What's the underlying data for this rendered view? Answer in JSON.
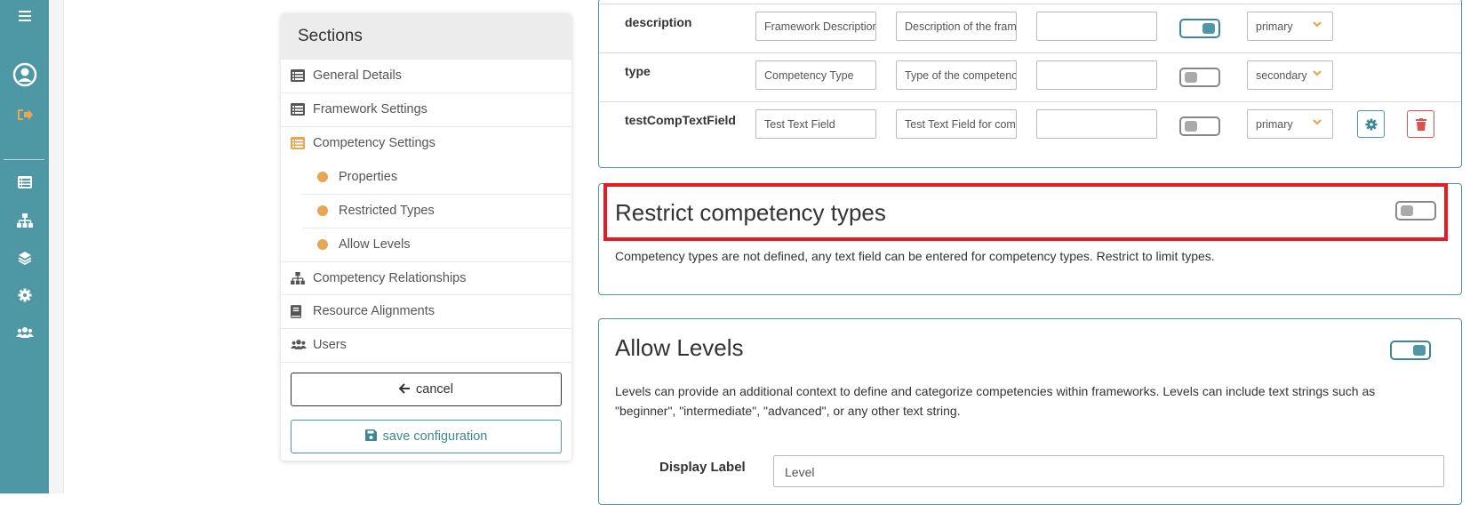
{
  "sidebar_icons": [
    "menu-icon",
    "user-circle-icon",
    "sign-out-icon",
    "list-icon",
    "sitemap-icon",
    "layers-icon",
    "gear-icon",
    "users-icon"
  ],
  "sections": {
    "title": "Sections",
    "items": [
      {
        "label": "General Details",
        "icon": "list-icon"
      },
      {
        "label": "Framework Settings",
        "icon": "list-icon"
      },
      {
        "label": "Competency Settings",
        "icon": "list-icon",
        "active": true
      },
      {
        "label": "Competency Relationships",
        "icon": "sitemap-icon"
      },
      {
        "label": "Resource Alignments",
        "icon": "book-icon"
      },
      {
        "label": "Users",
        "icon": "users-icon"
      }
    ],
    "subitems": [
      {
        "label": "Properties"
      },
      {
        "label": "Restricted Types"
      },
      {
        "label": "Allow Levels"
      }
    ],
    "cancel_label": "cancel",
    "save_label": "save configuration"
  },
  "properties": {
    "rows": [
      {
        "name": "description",
        "label": "Framework Description",
        "description": "Description of the framework",
        "extra": "",
        "required": true,
        "priority": "primary"
      },
      {
        "name": "type",
        "label": "Competency Type",
        "description": "Type of the competency",
        "extra": "",
        "required": false,
        "priority": "secondary"
      },
      {
        "name": "testCompTextField",
        "label": "Test Text Field",
        "description": "Test Text Field for competency",
        "extra": "",
        "required": false,
        "priority": "primary"
      }
    ]
  },
  "restrict": {
    "title": "Restrict competency types",
    "description": "Competency types are not defined, any text field can be entered for competency types. Restrict to limit types.",
    "enabled": false
  },
  "levels": {
    "title": "Allow Levels",
    "description_line1": "Levels can provide an additional context to define and categorize competencies within frameworks. Levels can include text strings such as",
    "description_line2": "\"beginner\", \"intermediate\", \"advanced\", or any other text string.",
    "enabled": true,
    "display_label": "Display Label",
    "display_value": "Level"
  },
  "colors": {
    "accent": "#4e97a4",
    "orange": "#e8a553",
    "danger": "#d9534f",
    "highlight": "#e51c23"
  }
}
